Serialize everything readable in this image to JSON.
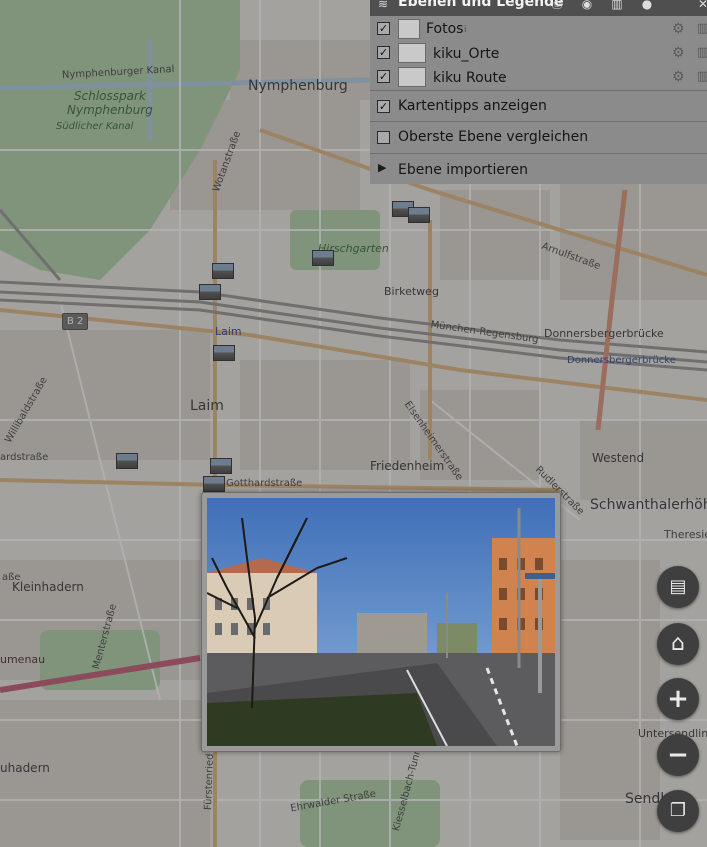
{
  "map": {
    "labels": {
      "nymphenburger_kanal": "Nymphenburger Kanal",
      "schlosspark": "Schlosspark",
      "nymphenburg_park": "Nymphenburg",
      "suedlicher_kanal": "Südlicher Kanal",
      "nymphenburg": "Nymphenburg",
      "wotanstrasse": "Wotanstraße",
      "hirschgarten": "Hirschgarten",
      "arnulfstrasse": "Arnulfstraße",
      "birketweg": "Birketweg",
      "muenchen_regensburg": "München-Regensburg",
      "donnersbergerbruecke": "Donnersbergerbrücke",
      "donnersbergerbruecke_station": "Donnersbergerbrücke",
      "b2": "B 2",
      "laim_station": "Laim",
      "laim": "Laim",
      "willibaldstrasse": "Willibaldstraße",
      "hardstrasse": "ardstraße",
      "gotthardstrasse": "Gotthardstraße",
      "friedenheim": "Friedenheim",
      "elsenheimerstrasse": "Elsenheimerstraße",
      "westend": "Westend",
      "rudlerstrasse": "Rudlerstraße",
      "schwanthalerhoehe": "Schwanthalerhöh",
      "theresie": "Theresie",
      "kleinhadern": "Kleinhadern",
      "menterstrasse": "Menterstraße",
      "umenau": "umenau",
      "strasse": "aße",
      "untersendling": "Untersendling",
      "uhadern": "uhadern",
      "fuerstenried": "Fürstenried",
      "ehrwalder_strasse": "Ehrwalder Straße",
      "kiesselbach": "Kiesselbach-Tunnel",
      "sendl": "Sendl",
      "nersbergerb": "nersbergerb"
    }
  },
  "layer_panel": {
    "title": "Ebenen und Legende",
    "layers": [
      {
        "name": "Fotos",
        "checked": "✓",
        "info": "i"
      },
      {
        "name": "kiku_Orte",
        "checked": "✓",
        "info": "i"
      },
      {
        "name": "kiku Route",
        "checked": "✓",
        "info": "i"
      }
    ],
    "options": {
      "kartentipps": {
        "label": "Kartentipps anzeigen",
        "checked": "✓"
      },
      "oberste_ebene": {
        "label": "Oberste Ebene vergleichen",
        "checked": ""
      },
      "importieren": {
        "label": "Ebene importieren",
        "arrow": "▶"
      }
    },
    "icons": [
      "layers-icon",
      "print-icon",
      "eye-icon",
      "trash-icon",
      "info-icon",
      "close-icon"
    ]
  },
  "map_controls": {
    "legend": "▤",
    "home": "⌂",
    "zoom_in": "+",
    "zoom_out": "−",
    "layers": "❐"
  },
  "colors": {
    "panel_bg": "#8b8b8b",
    "panel_header": "#4f4f4f",
    "route": "#c0506e",
    "button_bg": "#3f3f3f",
    "park": "#aacda0",
    "road_major": "#d9b07a"
  }
}
